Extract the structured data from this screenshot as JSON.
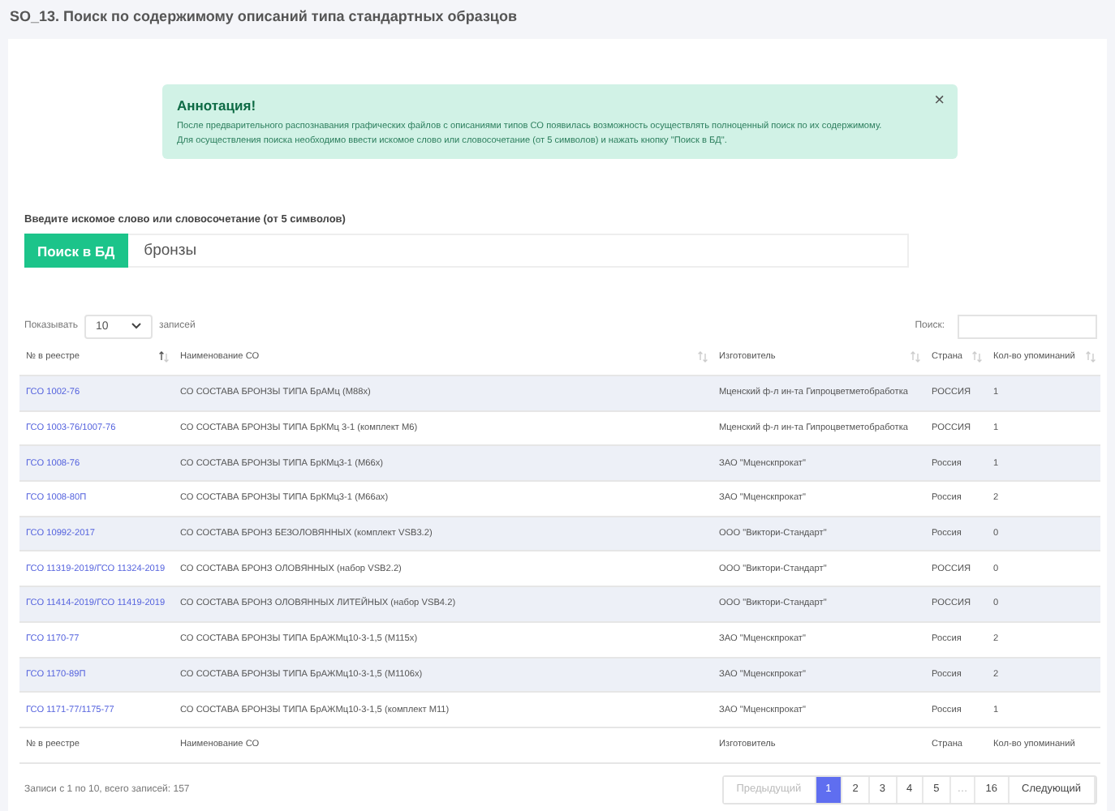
{
  "page_title": "SO_13. Поиск по содержимому описаний типа стандартных образцов",
  "alert": {
    "title": "Аннотация!",
    "close": "×",
    "lines": [
      "После предварительного распознавания графических файлов с описаниями типов СО появилась возможность осуществлять полноценный поиск по их содержимому.",
      "Для осуществления поиска необходимо ввести искомое слово или словосочетание (от 5 символов) и нажать кнопку \"Поиск в БД\"."
    ]
  },
  "search": {
    "label": "Введите искомое слово или словосочетание (от 5 символов)",
    "button": "Поиск в БД",
    "value": "бронзы"
  },
  "length": {
    "before": "Показывать",
    "value": "10",
    "after": "записей"
  },
  "filter": {
    "label": "Поиск:"
  },
  "columns": [
    {
      "label": "№ в реестре",
      "sorted": true
    },
    {
      "label": "Наименование СО",
      "sorted": false
    },
    {
      "label": "Изготовитель",
      "sorted": false
    },
    {
      "label": "Страна",
      "sorted": false
    },
    {
      "label": "Кол-во упоминаний",
      "sorted": false
    }
  ],
  "rows": [
    [
      "ГСО 1002-76",
      "СО СОСТАВА БРОНЗЫ ТИПА БрАМц (М88х)",
      "Мценский ф-л ин-та Гипроцветметобработка",
      "РОССИЯ",
      "1"
    ],
    [
      "ГСО 1003-76/1007-76",
      "СО СОСТАВА БРОНЗЫ ТИПА БрКМц 3-1 (комплект М6)",
      "Мценский ф-л ин-та Гипроцветметобработка",
      "РОССИЯ",
      "1"
    ],
    [
      "ГСО 1008-76",
      "СО СОСТАВА БРОНЗЫ ТИПА БрКМц3-1 (М66х)",
      "ЗАО \"Мценскпрокат\"",
      "Россия",
      "1"
    ],
    [
      "ГСО 1008-80П",
      "СО СОСТАВА БРОНЗЫ ТИПА БрКМц3-1 (М66ах)",
      "ЗАО \"Мценскпрокат\"",
      "Россия",
      "2"
    ],
    [
      "ГСО 10992-2017",
      "СО СОСТАВА БРОНЗ БЕЗОЛОВЯННЫХ (комплект VSB3.2)",
      "ООО \"Виктори-Стандарт\"",
      "Россия",
      "0"
    ],
    [
      "ГСО 11319-2019/ГСО 11324-2019",
      "СО СОСТАВА БРОНЗ ОЛОВЯННЫХ (набор VSB2.2)",
      "ООО \"Виктори-Стандарт\"",
      "РОССИЯ",
      "0"
    ],
    [
      "ГСО 11414-2019/ГСО 11419-2019",
      "СО СОСТАВА БРОНЗ ОЛОВЯННЫХ ЛИТЕЙНЫХ (набор VSB4.2)",
      "ООО \"Виктори-Стандарт\"",
      "РОССИЯ",
      "0"
    ],
    [
      "ГСО 1170-77",
      "СО СОСТАВА БРОНЗЫ ТИПА БрАЖМц10-3-1,5 (М115х)",
      "ЗАО \"Мценскпрокат\"",
      "Россия",
      "2"
    ],
    [
      "ГСО 1170-89П",
      "СО СОСТАВА БРОНЗЫ ТИПА БрАЖМц10-3-1,5 (М1106х)",
      "ЗАО \"Мценскпрокат\"",
      "Россия",
      "2"
    ],
    [
      "ГСО 1171-77/1175-77",
      "СО СОСТАВА БРОНЗЫ ТИПА БрАЖМц10-3-1,5 (комплект М11)",
      "ЗАО \"Мценскпрокат\"",
      "Россия",
      "1"
    ]
  ],
  "footer_columns": [
    "№ в реестре",
    "Наименование СО",
    "Изготовитель",
    "Страна",
    "Кол-во упоминаний"
  ],
  "info": "Записи с 1 по 10, всего записей: 157",
  "pagination": [
    {
      "label": "Предыдущий",
      "kind": "nav",
      "disabled": true,
      "selected": false
    },
    {
      "label": "1",
      "kind": "page",
      "disabled": false,
      "selected": true
    },
    {
      "label": "2",
      "kind": "page",
      "disabled": false,
      "selected": false
    },
    {
      "label": "3",
      "kind": "page",
      "disabled": false,
      "selected": false
    },
    {
      "label": "4",
      "kind": "page",
      "disabled": false,
      "selected": false
    },
    {
      "label": "5",
      "kind": "page",
      "disabled": false,
      "selected": false
    },
    {
      "label": "…",
      "kind": "gap",
      "disabled": true,
      "selected": false
    },
    {
      "label": "16",
      "kind": "page",
      "disabled": false,
      "selected": false
    },
    {
      "label": "Следующий",
      "kind": "nav",
      "disabled": false,
      "selected": false
    }
  ]
}
